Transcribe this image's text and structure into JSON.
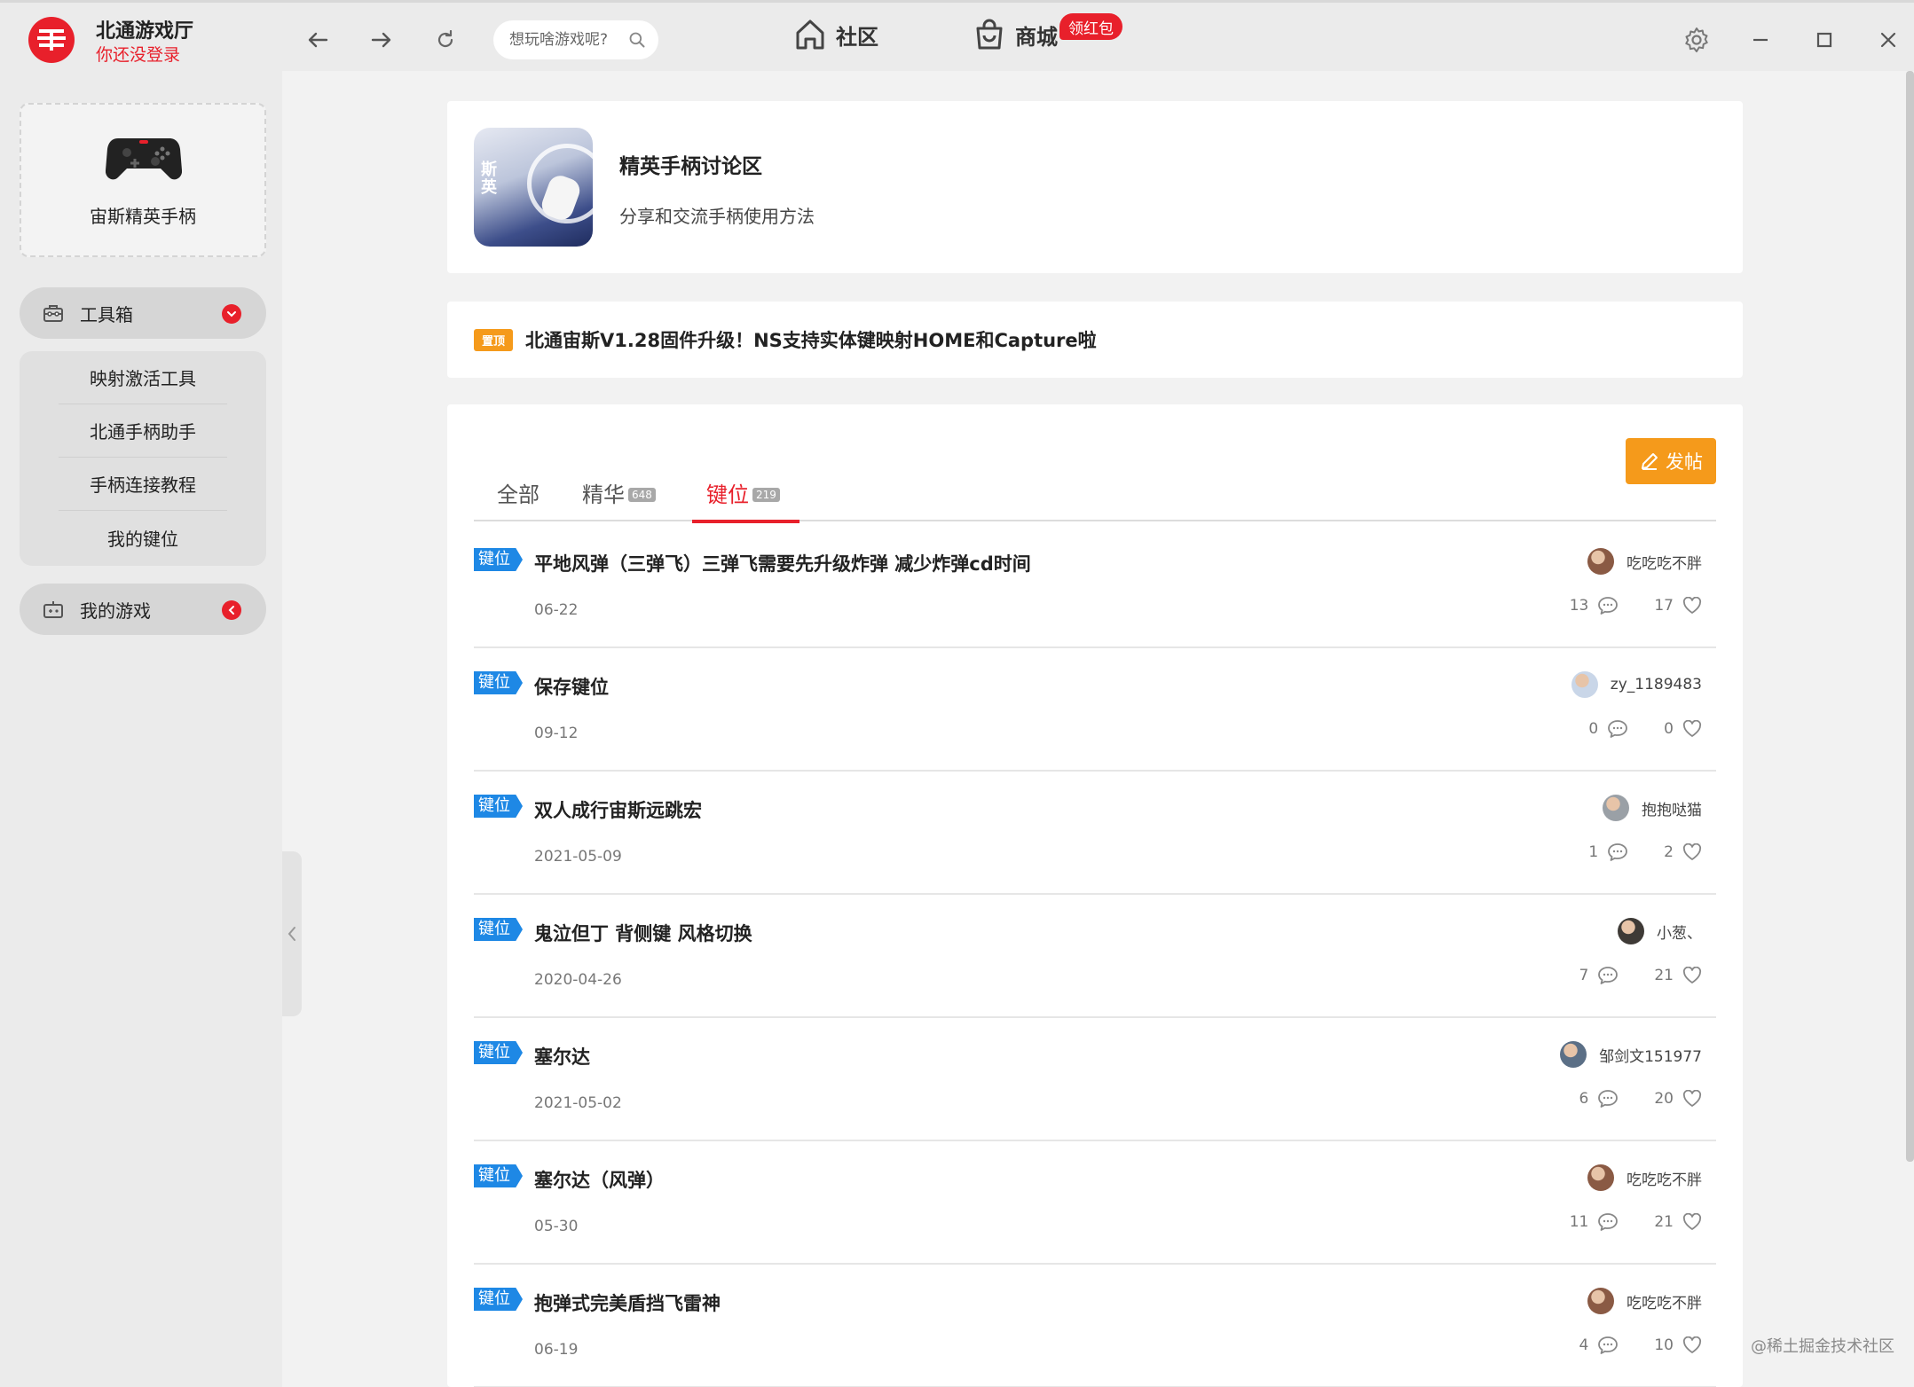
{
  "app": {
    "title": "北通游戏厅",
    "login_status": "你还没登录"
  },
  "search": {
    "placeholder": "想玩啥游戏呢?"
  },
  "top_nav": {
    "community": "社区",
    "shop": "商城",
    "shop_badge": "领红包"
  },
  "sidebar": {
    "device_name": "宙斯精英手柄",
    "toolbox_label": "工具箱",
    "toolbox_items": [
      "映射激活工具",
      "北通手柄助手",
      "手柄连接教程",
      "我的键位"
    ],
    "my_games_label": "我的游戏"
  },
  "forum": {
    "thumb_text": "斯\n英",
    "title": "精英手柄讨论区",
    "description": "分享和交流手柄使用方法"
  },
  "pinned": {
    "badge": "置顶",
    "title": "北通宙斯V1.28固件升级！NS支持实体键映射HOME和Capture啦"
  },
  "list": {
    "post_button": "发帖",
    "tabs": [
      {
        "label": "全部",
        "count": ""
      },
      {
        "label": "精华",
        "count": "648"
      },
      {
        "label": "键位",
        "count": "219"
      }
    ],
    "active_tab": "键位",
    "rows": [
      {
        "tag": "键位",
        "title": "平地风弹（三弹飞）三弹飞需要先升级炸弹 减少炸弹cd时间",
        "date": "06-22",
        "author": "吃吃吃不胖",
        "comments": "13",
        "likes": "17"
      },
      {
        "tag": "键位",
        "title": "保存键位",
        "date": "09-12",
        "author": "zy_1189483",
        "comments": "0",
        "likes": "0"
      },
      {
        "tag": "键位",
        "title": "双人成行宙斯远跳宏",
        "date": "2021-05-09",
        "author": "抱抱哒猫",
        "comments": "1",
        "likes": "2"
      },
      {
        "tag": "键位",
        "title": "鬼泣但丁 背侧键 风格切换",
        "date": "2020-04-26",
        "author": "小葱、",
        "comments": "7",
        "likes": "21"
      },
      {
        "tag": "键位",
        "title": "塞尔达",
        "date": "2021-05-02",
        "author": "邹剑文151977",
        "comments": "6",
        "likes": "20"
      },
      {
        "tag": "键位",
        "title": "塞尔达（风弹）",
        "date": "05-30",
        "author": "吃吃吃不胖",
        "comments": "11",
        "likes": "21"
      },
      {
        "tag": "键位",
        "title": "抱弹式完美盾挡飞雷神",
        "date": "06-19",
        "author": "吃吃吃不胖",
        "comments": "4",
        "likes": "10"
      }
    ]
  },
  "watermark": "@稀土掘金技术社区",
  "colors": {
    "brand_red": "#e8202b",
    "orange": "#f59a1b",
    "tag_blue": "#1e88e5"
  }
}
